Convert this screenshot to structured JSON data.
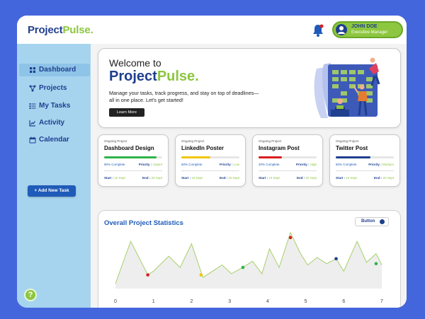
{
  "app": {
    "logo_part1": "Project",
    "logo_part2": "Pulse."
  },
  "user": {
    "name": "JOHN DOE",
    "role": "Executive Manager"
  },
  "sidebar": {
    "items": [
      {
        "label": "Dashboard",
        "icon": "dashboard-icon",
        "active": true
      },
      {
        "label": "Projects",
        "icon": "projects-icon",
        "active": false
      },
      {
        "label": "My Tasks",
        "icon": "tasks-icon",
        "active": false
      },
      {
        "label": "Activity",
        "icon": "activity-icon",
        "active": false
      },
      {
        "label": "Calendar",
        "icon": "calendar-icon",
        "active": false
      }
    ],
    "add_button": "+ Add New Task",
    "help_icon": "?"
  },
  "welcome": {
    "greeting": "Welcome to",
    "brand_part1": "Project",
    "brand_part2": "Pulse.",
    "description": "Manage your tasks, track progress, and stay on top of deadlines—all in one place. Let's get started!",
    "button": "Learn More"
  },
  "projects": [
    {
      "tag": "Ongoing Project",
      "title": "Dashboard Design",
      "progress": 0.9,
      "color": "#2fb34a",
      "percent": "90% Complete",
      "priority_label": "Priority :",
      "priority": "Urgent",
      "start_label": "Start :",
      "start": "10 Sept",
      "end_label": "End :",
      "end": "20 Sept"
    },
    {
      "tag": "Ongoing Project",
      "title": "LinkedIn Poster",
      "progress": 0.5,
      "color": "#f2c500",
      "percent": "50% Complete",
      "priority_label": "Priority :",
      "priority": "Low",
      "start_label": "Start :",
      "start": "10 Sept",
      "end_label": "End :",
      "end": "20 Sept"
    },
    {
      "tag": "Ongoing Project",
      "title": "Instagram Post",
      "progress": 0.4,
      "color": "#d81e1e",
      "percent": "20% Complete",
      "priority_label": "Priority :",
      "priority": "High",
      "start_label": "Start :",
      "start": "10 Sept",
      "end_label": "End :",
      "end": "20 Sept"
    },
    {
      "tag": "Ongoing Project",
      "title": "Twitter Post",
      "progress": 0.6,
      "color": "#1f3f8f",
      "percent": "60% Complete",
      "priority_label": "Priority :",
      "priority": "Medium",
      "start_label": "Start :",
      "start": "10 Sept",
      "end_label": "End :",
      "end": "20 Sept"
    }
  ],
  "stats": {
    "title": "Overall Project Statistics",
    "button": "Button"
  },
  "chart_data": {
    "type": "area",
    "x": [
      0,
      0.4,
      0.85,
      1.0,
      1.4,
      1.7,
      2.0,
      2.3,
      2.55,
      2.8,
      3.05,
      3.35,
      3.6,
      3.85,
      4.05,
      4.3,
      4.6,
      4.85,
      5.05,
      5.3,
      5.55,
      5.8,
      6.0,
      6.35,
      6.6,
      6.85,
      7.0
    ],
    "y": [
      0.2,
      1.9,
      0.55,
      0.7,
      1.3,
      0.85,
      1.8,
      0.45,
      0.7,
      0.95,
      0.6,
      0.85,
      1.1,
      0.6,
      1.6,
      0.85,
      2.25,
      1.45,
      0.95,
      1.25,
      1.0,
      1.2,
      0.7,
      1.9,
      1.05,
      1.4,
      0.95
    ],
    "markers": [
      {
        "x": 0.85,
        "y": 0.55,
        "color": "#d81e1e"
      },
      {
        "x": 2.25,
        "y": 0.55,
        "color": "#f2c500"
      },
      {
        "x": 3.35,
        "y": 0.85,
        "color": "#2fb34a"
      },
      {
        "x": 4.6,
        "y": 2.05,
        "color": "#d81e1e"
      },
      {
        "x": 5.8,
        "y": 1.2,
        "color": "#1f3f8f"
      },
      {
        "x": 6.85,
        "y": 1.0,
        "color": "#2fb34a"
      }
    ],
    "x_ticks": [
      "0",
      "1",
      "2",
      "3",
      "4",
      "5",
      "6",
      "7"
    ],
    "xlim": [
      0,
      7
    ],
    "ylim": [
      0,
      2.5
    ],
    "line_color": "#a8cf6a",
    "fill_color": "#eeeeee",
    "grid": false
  }
}
